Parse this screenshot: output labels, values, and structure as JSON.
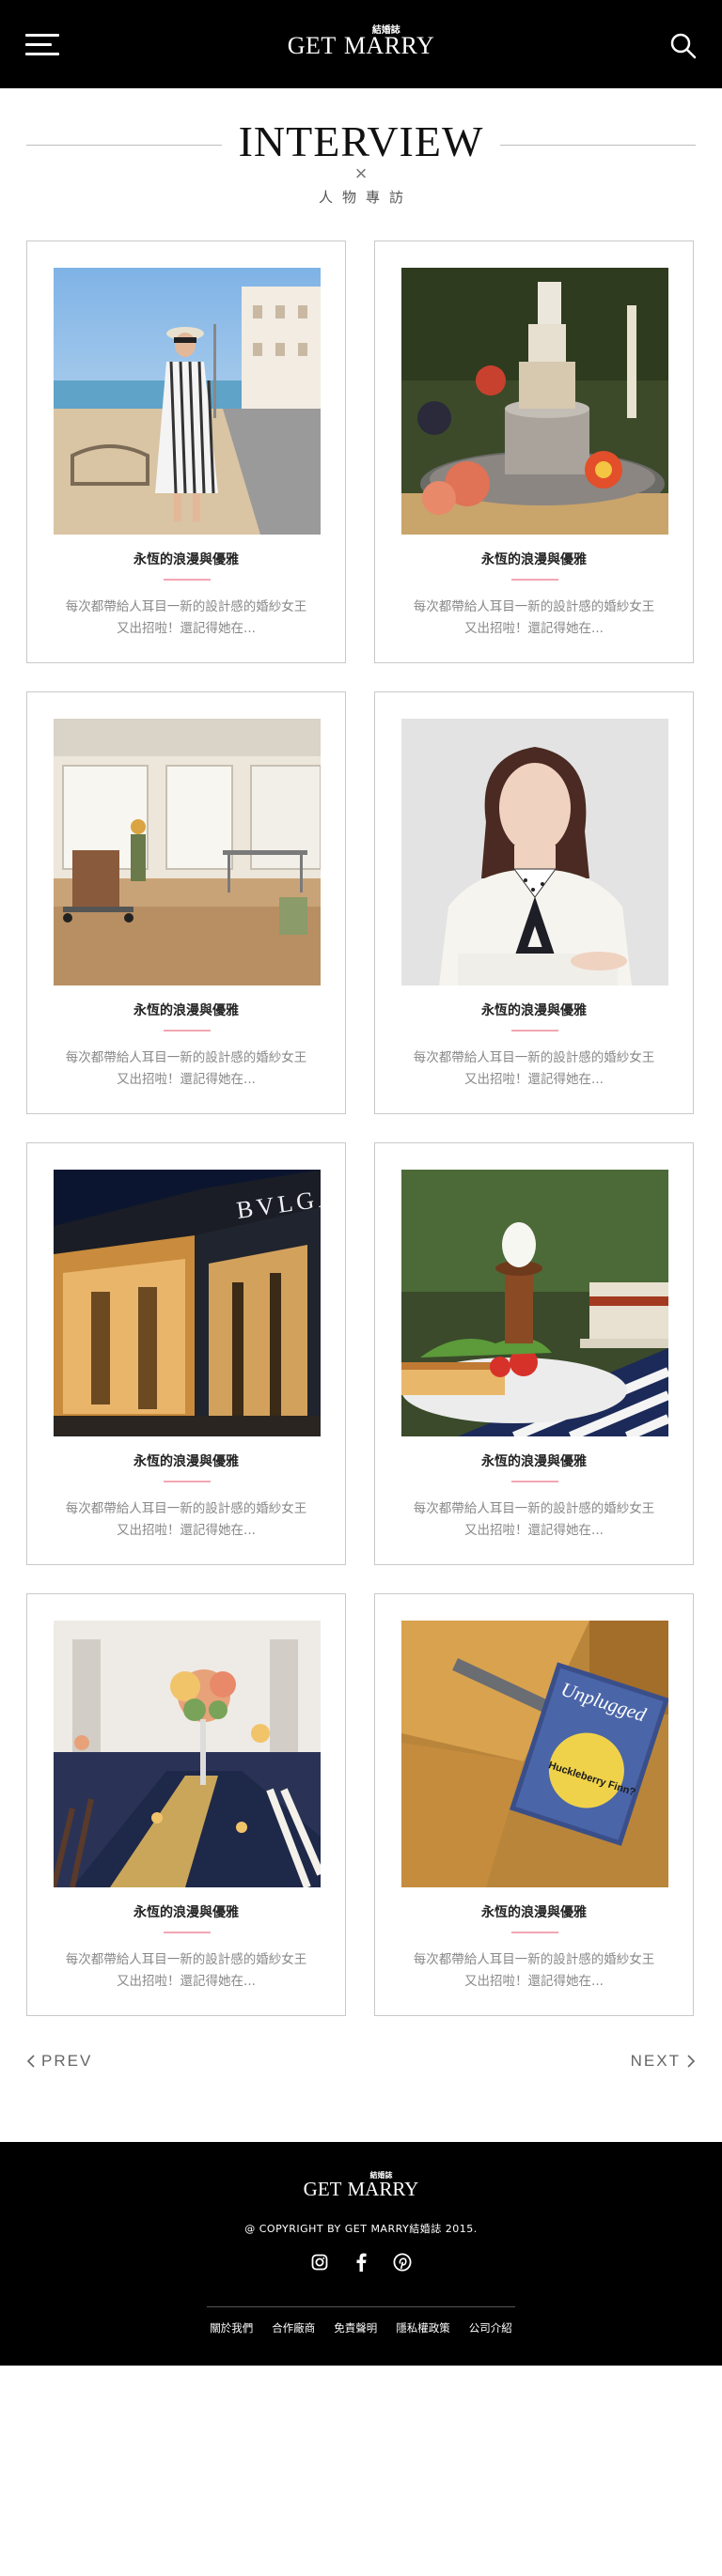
{
  "header": {
    "logo_get": "GET",
    "logo_marry": "MARRY",
    "logo_sub": "結婚誌",
    "menu_icon": "hamburger-menu-icon",
    "search_icon": "search-icon"
  },
  "section": {
    "title": "INTERVIEW",
    "divider_glyph": "×",
    "subtitle": "人物專訪"
  },
  "cards": [
    {
      "title": "永恆的浪漫與優雅",
      "desc": "每次都帶給人耳目一新的設計感的婚紗女王又出招啦！還記得她在...",
      "photo": "beach-woman-photo"
    },
    {
      "title": "永恆的浪漫與優雅",
      "desc": "每次都帶給人耳目一新的設計感的婚紗女王又出招啦！還記得她在...",
      "photo": "cheese-tower-photo"
    },
    {
      "title": "永恆的浪漫與優雅",
      "desc": "每次都帶給人耳目一新的設計感的婚紗女王又出招啦！還記得她在...",
      "photo": "studio-workshop-photo"
    },
    {
      "title": "永恆的浪漫與優雅",
      "desc": "每次都帶給人耳目一新的設計感的婚紗女王又出招啦！還記得她在...",
      "photo": "woman-portrait-photo"
    },
    {
      "title": "永恆的浪漫與優雅",
      "desc": "每次都帶給人耳目一新的設計感的婚紗女王又出招啦！還記得她在...",
      "photo": "bvlgari-storefront-photo",
      "sign_text": "BVLGARI"
    },
    {
      "title": "永恆的浪漫與優雅",
      "desc": "每次都帶給人耳目一新的設計感的婚紗女王又出招啦！還記得她在...",
      "photo": "breakfast-table-photo"
    },
    {
      "title": "永恆的浪漫與優雅",
      "desc": "每次都帶給人耳目一新的設計感的婚紗女王又出招啦！還記得她在...",
      "photo": "wedding-banquet-photo"
    },
    {
      "title": "永恆的浪漫與優雅",
      "desc": "每次都帶給人耳目一新的設計感的婚紗女王又出招啦！還記得她在...",
      "photo": "magazine-on-chair-photo",
      "magazine_title": "Unplugged",
      "magazine_text": "Huckleberry Finn?"
    }
  ],
  "pager": {
    "prev": "PREV",
    "next": "NEXT"
  },
  "footer": {
    "logo_get": "GET",
    "logo_marry": "MARRY",
    "logo_sub": "結婚誌",
    "copyright": "@ COPYRIGHT BY GET MARRY結婚誌 2015.",
    "social": [
      "instagram-icon",
      "facebook-icon",
      "pinterest-icon"
    ],
    "links": [
      "關於我們",
      "合作廠商",
      "免責聲明",
      "隱私權政策",
      "公司介紹"
    ]
  },
  "colors": {
    "header_bg": "#000000",
    "accent_pink": "#f3a6b3",
    "card_border": "#c9c9c9"
  }
}
